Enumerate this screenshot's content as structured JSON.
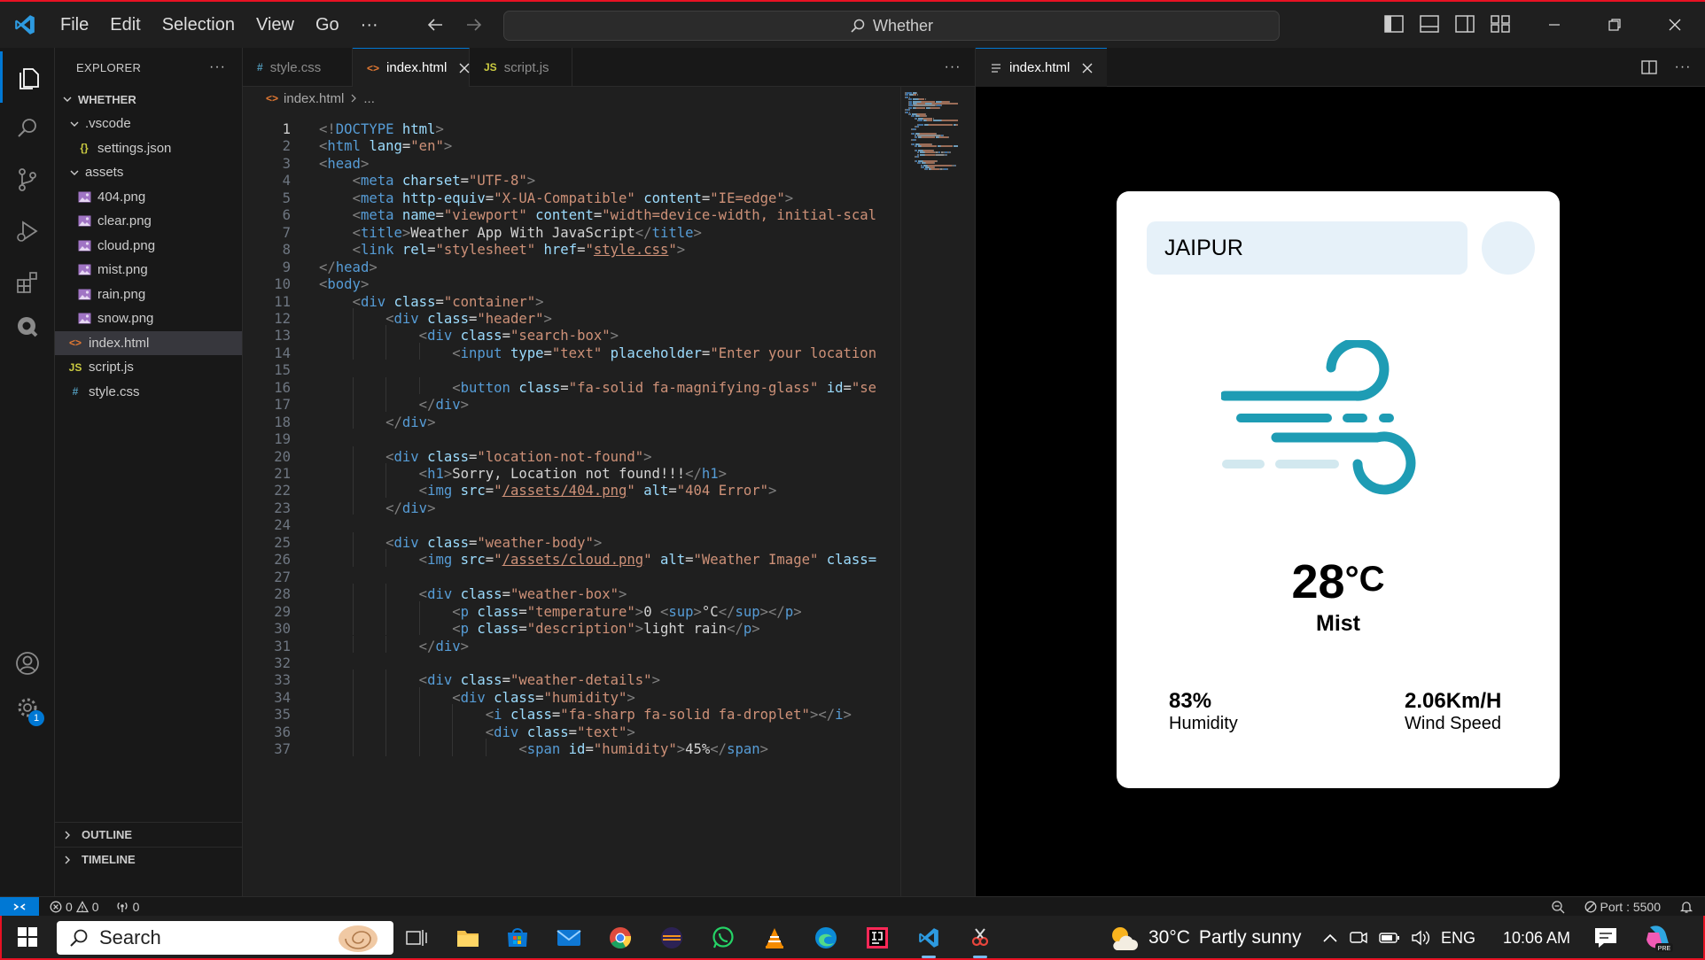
{
  "titlebar": {
    "menu": [
      "File",
      "Edit",
      "Selection",
      "View",
      "Go",
      "···"
    ],
    "command_center": "Whether"
  },
  "sidebar": {
    "header": "EXPLORER",
    "root": "WHETHER",
    "tree": [
      {
        "name": ".vscode",
        "kind": "folder",
        "depth": 1
      },
      {
        "name": "settings.json",
        "kind": "json",
        "depth": 2
      },
      {
        "name": "assets",
        "kind": "folder",
        "depth": 1
      },
      {
        "name": "404.png",
        "kind": "image",
        "depth": 2
      },
      {
        "name": "clear.png",
        "kind": "image",
        "depth": 2
      },
      {
        "name": "cloud.png",
        "kind": "image",
        "depth": 2
      },
      {
        "name": "mist.png",
        "kind": "image",
        "depth": 2
      },
      {
        "name": "rain.png",
        "kind": "image",
        "depth": 2
      },
      {
        "name": "snow.png",
        "kind": "image",
        "depth": 2
      },
      {
        "name": "index.html",
        "kind": "html",
        "depth": 1,
        "selected": true
      },
      {
        "name": "script.js",
        "kind": "js",
        "depth": 1
      },
      {
        "name": "style.css",
        "kind": "css",
        "depth": 1
      }
    ],
    "outline": "OUTLINE",
    "timeline": "TIMELINE",
    "icon_glyphs": {
      "json": "{}",
      "js": "JS",
      "css": "#"
    }
  },
  "activitybar": {
    "settings_badge": "1"
  },
  "editor": {
    "tabs": [
      {
        "label": "style.css",
        "icon": "#",
        "icon_color": "#519aba",
        "active": false
      },
      {
        "label": "index.html",
        "icon": "<>",
        "icon_color": "#e37933",
        "active": true
      },
      {
        "label": "script.js",
        "icon": "JS",
        "icon_color": "#cbcb41",
        "active": false
      }
    ],
    "breadcrumb": {
      "file": "index.html",
      "rest": "..."
    },
    "current_line": 1,
    "lines": [
      [
        [
          "tg",
          "<!"
        ],
        [
          "tn",
          "DOCTYPE"
        ],
        [
          "tx",
          " "
        ],
        [
          "at",
          "html"
        ],
        [
          "tg",
          ">"
        ]
      ],
      [
        [
          "tg",
          "<"
        ],
        [
          "tn",
          "html"
        ],
        [
          "tx",
          " "
        ],
        [
          "at",
          "lang"
        ],
        [
          "tx",
          "="
        ],
        [
          "av",
          "\"en\""
        ],
        [
          "tg",
          ">"
        ]
      ],
      [
        [
          "tg",
          "<"
        ],
        [
          "tn",
          "head"
        ],
        [
          "tg",
          ">"
        ]
      ],
      [
        [
          "tx",
          "    "
        ],
        [
          "tg",
          "<"
        ],
        [
          "tn",
          "meta"
        ],
        [
          "tx",
          " "
        ],
        [
          "at",
          "charset"
        ],
        [
          "tx",
          "="
        ],
        [
          "av",
          "\"UTF-8\""
        ],
        [
          "tg",
          ">"
        ]
      ],
      [
        [
          "tx",
          "    "
        ],
        [
          "tg",
          "<"
        ],
        [
          "tn",
          "meta"
        ],
        [
          "tx",
          " "
        ],
        [
          "at",
          "http-equiv"
        ],
        [
          "tx",
          "="
        ],
        [
          "av",
          "\"X-UA-Compatible\""
        ],
        [
          "tx",
          " "
        ],
        [
          "at",
          "content"
        ],
        [
          "tx",
          "="
        ],
        [
          "av",
          "\"IE=edge\""
        ],
        [
          "tg",
          ">"
        ]
      ],
      [
        [
          "tx",
          "    "
        ],
        [
          "tg",
          "<"
        ],
        [
          "tn",
          "meta"
        ],
        [
          "tx",
          " "
        ],
        [
          "at",
          "name"
        ],
        [
          "tx",
          "="
        ],
        [
          "av",
          "\"viewport\""
        ],
        [
          "tx",
          " "
        ],
        [
          "at",
          "content"
        ],
        [
          "tx",
          "="
        ],
        [
          "av",
          "\"width=device-width, initial-scal"
        ]
      ],
      [
        [
          "tx",
          "    "
        ],
        [
          "tg",
          "<"
        ],
        [
          "tn",
          "title"
        ],
        [
          "tg",
          ">"
        ],
        [
          "tx",
          "Weather App With JavaScript"
        ],
        [
          "tg",
          "</"
        ],
        [
          "tn",
          "title"
        ],
        [
          "tg",
          ">"
        ]
      ],
      [
        [
          "tx",
          "    "
        ],
        [
          "tg",
          "<"
        ],
        [
          "tn",
          "link"
        ],
        [
          "tx",
          " "
        ],
        [
          "at",
          "rel"
        ],
        [
          "tx",
          "="
        ],
        [
          "av",
          "\"stylesheet\""
        ],
        [
          "tx",
          " "
        ],
        [
          "at",
          "href"
        ],
        [
          "tx",
          "="
        ],
        [
          "av",
          "\""
        ],
        [
          "av u",
          "style.css"
        ],
        [
          "av",
          "\""
        ],
        [
          "tg",
          ">"
        ]
      ],
      [
        [
          "tg",
          "</"
        ],
        [
          "tn",
          "head"
        ],
        [
          "tg",
          ">"
        ]
      ],
      [
        [
          "tg",
          "<"
        ],
        [
          "tn",
          "body"
        ],
        [
          "tg",
          ">"
        ]
      ],
      [
        [
          "tx",
          "    "
        ],
        [
          "tg",
          "<"
        ],
        [
          "tn",
          "div"
        ],
        [
          "tx",
          " "
        ],
        [
          "at",
          "class"
        ],
        [
          "tx",
          "="
        ],
        [
          "av",
          "\"container\""
        ],
        [
          "tg",
          ">"
        ]
      ],
      [
        [
          "tx",
          "        "
        ],
        [
          "tg",
          "<"
        ],
        [
          "tn",
          "div"
        ],
        [
          "tx",
          " "
        ],
        [
          "at",
          "class"
        ],
        [
          "tx",
          "="
        ],
        [
          "av",
          "\"header\""
        ],
        [
          "tg",
          ">"
        ]
      ],
      [
        [
          "tx",
          "            "
        ],
        [
          "tg",
          "<"
        ],
        [
          "tn",
          "div"
        ],
        [
          "tx",
          " "
        ],
        [
          "at",
          "class"
        ],
        [
          "tx",
          "="
        ],
        [
          "av",
          "\"search-box\""
        ],
        [
          "tg",
          ">"
        ]
      ],
      [
        [
          "tx",
          "                "
        ],
        [
          "tg",
          "<"
        ],
        [
          "tn",
          "input"
        ],
        [
          "tx",
          " "
        ],
        [
          "at",
          "type"
        ],
        [
          "tx",
          "="
        ],
        [
          "av",
          "\"text\""
        ],
        [
          "tx",
          " "
        ],
        [
          "at",
          "placeholder"
        ],
        [
          "tx",
          "="
        ],
        [
          "av",
          "\"Enter your location"
        ]
      ],
      [
        [
          "tx",
          ""
        ]
      ],
      [
        [
          "tx",
          "                "
        ],
        [
          "tg",
          "<"
        ],
        [
          "tn",
          "button"
        ],
        [
          "tx",
          " "
        ],
        [
          "at",
          "class"
        ],
        [
          "tx",
          "="
        ],
        [
          "av",
          "\"fa-solid fa-magnifying-glass\""
        ],
        [
          "tx",
          " "
        ],
        [
          "at",
          "id"
        ],
        [
          "tx",
          "="
        ],
        [
          "av",
          "\"se"
        ]
      ],
      [
        [
          "tx",
          "            "
        ],
        [
          "tg",
          "</"
        ],
        [
          "tn",
          "div"
        ],
        [
          "tg",
          ">"
        ]
      ],
      [
        [
          "tx",
          "        "
        ],
        [
          "tg",
          "</"
        ],
        [
          "tn",
          "div"
        ],
        [
          "tg",
          ">"
        ]
      ],
      [
        [
          "tx",
          ""
        ]
      ],
      [
        [
          "tx",
          "        "
        ],
        [
          "tg",
          "<"
        ],
        [
          "tn",
          "div"
        ],
        [
          "tx",
          " "
        ],
        [
          "at",
          "class"
        ],
        [
          "tx",
          "="
        ],
        [
          "av",
          "\"location-not-found\""
        ],
        [
          "tg",
          ">"
        ]
      ],
      [
        [
          "tx",
          "            "
        ],
        [
          "tg",
          "<"
        ],
        [
          "tn",
          "h1"
        ],
        [
          "tg",
          ">"
        ],
        [
          "tx",
          "Sorry, Location not found!!!"
        ],
        [
          "tg",
          "</"
        ],
        [
          "tn",
          "h1"
        ],
        [
          "tg",
          ">"
        ]
      ],
      [
        [
          "tx",
          "            "
        ],
        [
          "tg",
          "<"
        ],
        [
          "tn",
          "img"
        ],
        [
          "tx",
          " "
        ],
        [
          "at",
          "src"
        ],
        [
          "tx",
          "="
        ],
        [
          "av",
          "\""
        ],
        [
          "av u",
          "/assets/404.png"
        ],
        [
          "av",
          "\""
        ],
        [
          "tx",
          " "
        ],
        [
          "at",
          "alt"
        ],
        [
          "tx",
          "="
        ],
        [
          "av",
          "\"404 Error\""
        ],
        [
          "tg",
          ">"
        ]
      ],
      [
        [
          "tx",
          "        "
        ],
        [
          "tg",
          "</"
        ],
        [
          "tn",
          "div"
        ],
        [
          "tg",
          ">"
        ]
      ],
      [
        [
          "tx",
          ""
        ]
      ],
      [
        [
          "tx",
          "        "
        ],
        [
          "tg",
          "<"
        ],
        [
          "tn",
          "div"
        ],
        [
          "tx",
          " "
        ],
        [
          "at",
          "class"
        ],
        [
          "tx",
          "="
        ],
        [
          "av",
          "\"weather-body\""
        ],
        [
          "tg",
          ">"
        ]
      ],
      [
        [
          "tx",
          "            "
        ],
        [
          "tg",
          "<"
        ],
        [
          "tn",
          "img"
        ],
        [
          "tx",
          " "
        ],
        [
          "at",
          "src"
        ],
        [
          "tx",
          "="
        ],
        [
          "av",
          "\""
        ],
        [
          "av u",
          "/assets/cloud.png"
        ],
        [
          "av",
          "\""
        ],
        [
          "tx",
          " "
        ],
        [
          "at",
          "alt"
        ],
        [
          "tx",
          "="
        ],
        [
          "av",
          "\"Weather Image\""
        ],
        [
          "tx",
          " "
        ],
        [
          "at",
          "class="
        ]
      ],
      [
        [
          "tx",
          ""
        ]
      ],
      [
        [
          "tx",
          "            "
        ],
        [
          "tg",
          "<"
        ],
        [
          "tn",
          "div"
        ],
        [
          "tx",
          " "
        ],
        [
          "at",
          "class"
        ],
        [
          "tx",
          "="
        ],
        [
          "av",
          "\"weather-box\""
        ],
        [
          "tg",
          ">"
        ]
      ],
      [
        [
          "tx",
          "                "
        ],
        [
          "tg",
          "<"
        ],
        [
          "tn",
          "p"
        ],
        [
          "tx",
          " "
        ],
        [
          "at",
          "class"
        ],
        [
          "tx",
          "="
        ],
        [
          "av",
          "\"temperature\""
        ],
        [
          "tg",
          ">"
        ],
        [
          "tx",
          "0 "
        ],
        [
          "tg",
          "<"
        ],
        [
          "tn",
          "sup"
        ],
        [
          "tg",
          ">"
        ],
        [
          "tx",
          "°C"
        ],
        [
          "tg",
          "</"
        ],
        [
          "tn",
          "sup"
        ],
        [
          "tg",
          "></"
        ],
        [
          "tn",
          "p"
        ],
        [
          "tg",
          ">"
        ]
      ],
      [
        [
          "tx",
          "                "
        ],
        [
          "tg",
          "<"
        ],
        [
          "tn",
          "p"
        ],
        [
          "tx",
          " "
        ],
        [
          "at",
          "class"
        ],
        [
          "tx",
          "="
        ],
        [
          "av",
          "\"description\""
        ],
        [
          "tg",
          ">"
        ],
        [
          "tx",
          "light rain"
        ],
        [
          "tg",
          "</"
        ],
        [
          "tn",
          "p"
        ],
        [
          "tg",
          ">"
        ]
      ],
      [
        [
          "tx",
          "            "
        ],
        [
          "tg",
          "</"
        ],
        [
          "tn",
          "div"
        ],
        [
          "tg",
          ">"
        ]
      ],
      [
        [
          "tx",
          ""
        ]
      ],
      [
        [
          "tx",
          "            "
        ],
        [
          "tg",
          "<"
        ],
        [
          "tn",
          "div"
        ],
        [
          "tx",
          " "
        ],
        [
          "at",
          "class"
        ],
        [
          "tx",
          "="
        ],
        [
          "av",
          "\"weather-details\""
        ],
        [
          "tg",
          ">"
        ]
      ],
      [
        [
          "tx",
          "                "
        ],
        [
          "tg",
          "<"
        ],
        [
          "tn",
          "div"
        ],
        [
          "tx",
          " "
        ],
        [
          "at",
          "class"
        ],
        [
          "tx",
          "="
        ],
        [
          "av",
          "\"humidity\""
        ],
        [
          "tg",
          ">"
        ]
      ],
      [
        [
          "tx",
          "                    "
        ],
        [
          "tg",
          "<"
        ],
        [
          "tn",
          "i"
        ],
        [
          "tx",
          " "
        ],
        [
          "at",
          "class"
        ],
        [
          "tx",
          "="
        ],
        [
          "av",
          "\"fa-sharp fa-solid fa-droplet\""
        ],
        [
          "tg",
          "></"
        ],
        [
          "tn",
          "i"
        ],
        [
          "tg",
          ">"
        ]
      ],
      [
        [
          "tx",
          "                    "
        ],
        [
          "tg",
          "<"
        ],
        [
          "tn",
          "div"
        ],
        [
          "tx",
          " "
        ],
        [
          "at",
          "class"
        ],
        [
          "tx",
          "="
        ],
        [
          "av",
          "\"text\""
        ],
        [
          "tg",
          ">"
        ]
      ],
      [
        [
          "tx",
          "                        "
        ],
        [
          "tg",
          "<"
        ],
        [
          "tn",
          "span"
        ],
        [
          "tx",
          " "
        ],
        [
          "at",
          "id"
        ],
        [
          "tx",
          "="
        ],
        [
          "av",
          "\"humidity\""
        ],
        [
          "tg",
          ">"
        ],
        [
          "tx",
          "45%"
        ],
        [
          "tg",
          "</"
        ],
        [
          "tn",
          "span"
        ],
        [
          "tg",
          ">"
        ]
      ]
    ]
  },
  "preview": {
    "tab_label": "index.html",
    "location": "JAIPUR",
    "temperature": "28",
    "temp_unit": "°C",
    "description": "Mist",
    "humidity_value": "83%",
    "humidity_label": "Humidity",
    "wind_value": "2.06Km/H",
    "wind_label": "Wind Speed",
    "accent_color": "#1e9cb4"
  },
  "statusbar": {
    "errors": "0",
    "warnings": "0",
    "ports": "0",
    "port_label": "Port : 5500"
  },
  "taskbar": {
    "search_label": "Search",
    "weather_temp": "30°C",
    "weather_desc": "Partly sunny",
    "language": "ENG",
    "time": "10:06 AM"
  }
}
